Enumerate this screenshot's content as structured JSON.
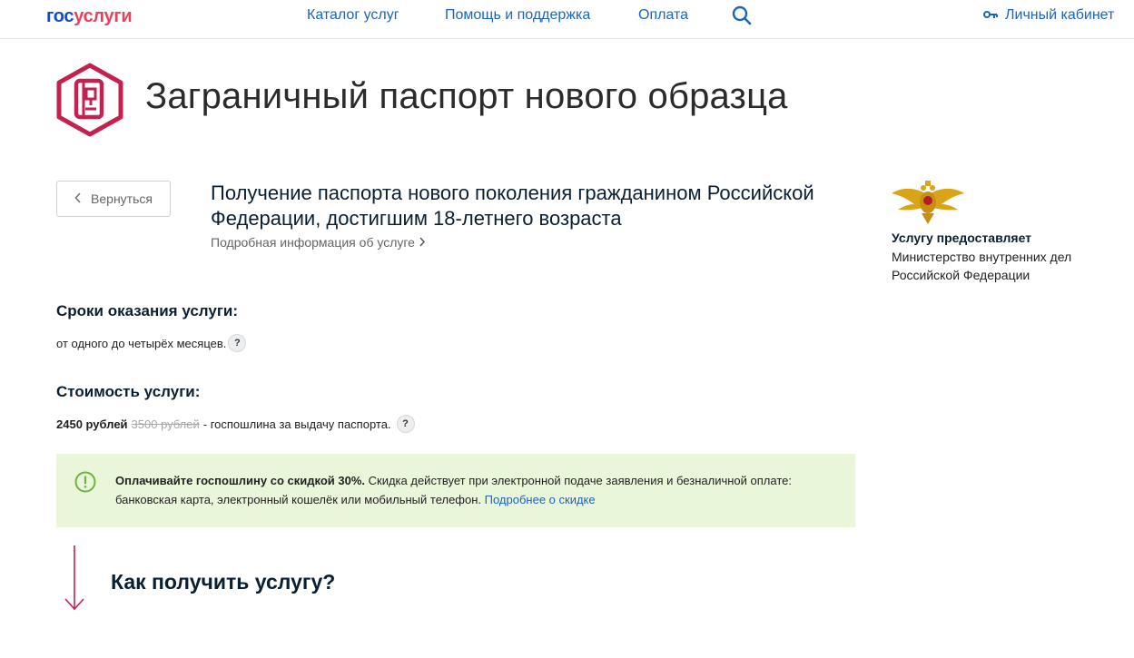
{
  "header": {
    "logo_part1": "гос",
    "logo_part2": "услуги",
    "nav": [
      "Каталог услуг",
      "Помощь и поддержка",
      "Оплата"
    ],
    "cabinet": "Личный кабинет"
  },
  "title": "Заграничный паспорт нового образца",
  "back_label": "Вернуться",
  "service": {
    "name": "Получение паспорта нового поколения гражданином Российской Федерации, достигшим 18-летнего возраста",
    "more": "Подробная информация об услуге"
  },
  "provider": {
    "label": "Услугу предоставляет",
    "name": "Министерство внутренних дел Российской Федерации"
  },
  "terms": {
    "title": "Сроки оказания услуги:",
    "text": "от одного до четырёх месяцев."
  },
  "cost": {
    "title": "Стоимость услуги:",
    "price": "2450 рублей",
    "old_price": "3500 рублей",
    "description": "- госпошлина за выдачу паспорта."
  },
  "help_mark": "?",
  "discount": {
    "bold": "Оплачивайте госпошлину со скидкой 30%.",
    "text": " Скидка действует при электронной подаче заявления и безналичной оплате: банковская карта, электронный кошелёк или мобильный телефон. ",
    "link": "Подробнее о скидке"
  },
  "howto": "Как получить услугу?",
  "icons": {
    "search": "search-icon",
    "key": "key-icon",
    "service": "passport-icon",
    "emblem": "mvd-emblem-icon",
    "info": "exclamation-circle-icon",
    "arrow": "arrow-down-icon"
  },
  "colors": {
    "brand_blue": "#0d4cd3",
    "brand_red": "#ee3f58",
    "link": "#1b64c3",
    "icon_accent": "#c4214f",
    "banner_bg": "#eaf6da",
    "banner_icon": "#6cb33f"
  }
}
